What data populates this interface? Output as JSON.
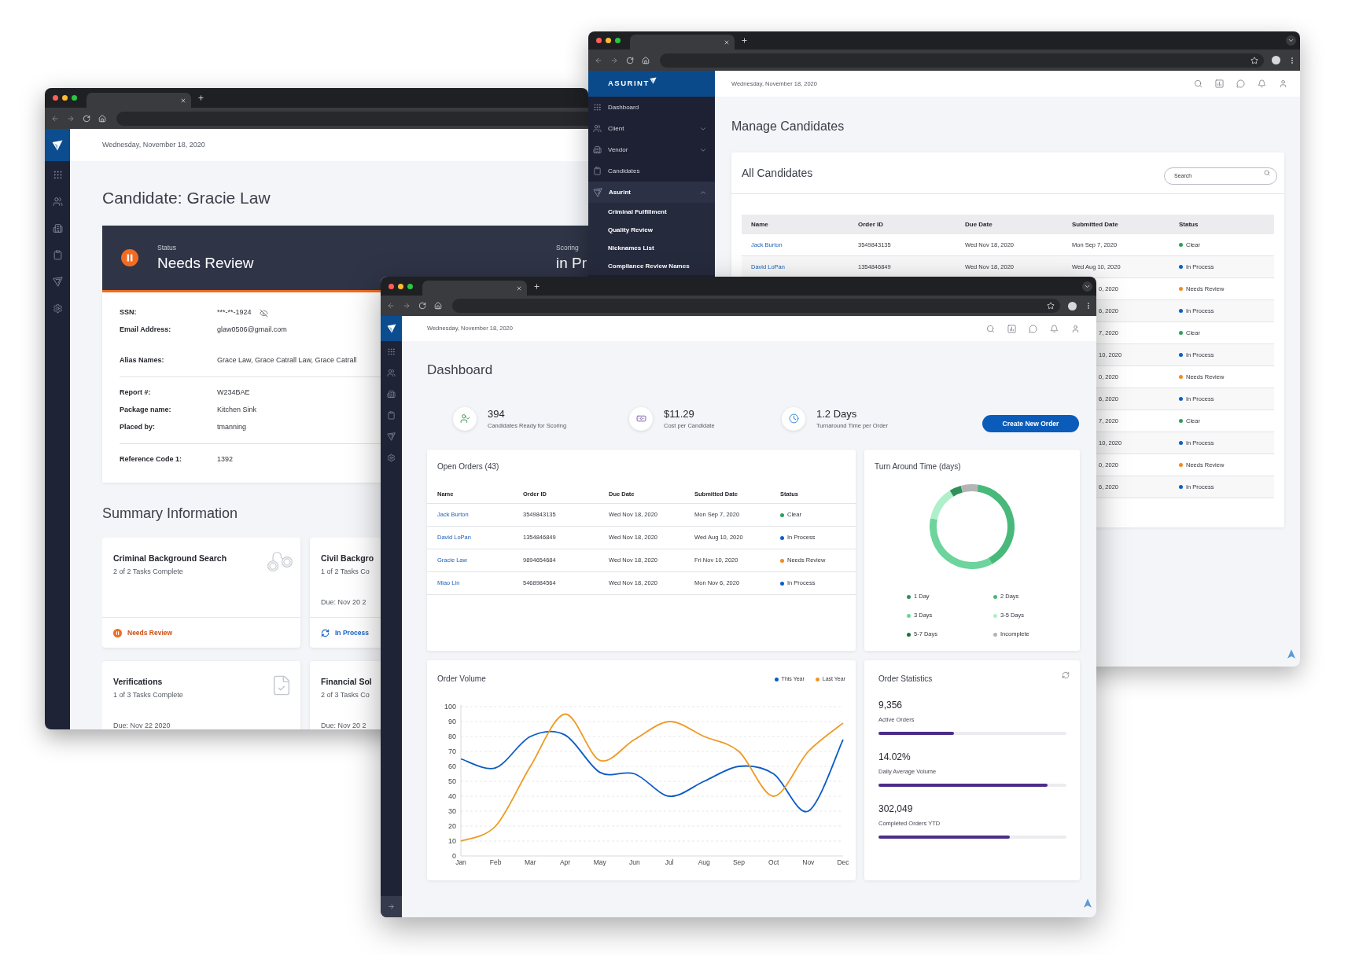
{
  "candidate_window": {
    "date": "Wednesday, November 18, 2020",
    "title": "Candidate: Gracie Law",
    "status": {
      "label": "Status",
      "value": "Needs Review"
    },
    "scoring": {
      "label": "Scoring",
      "value": "in Pr"
    },
    "details": [
      [
        {
          "label": "SSN:",
          "value": "***-**-1924",
          "masked": true
        },
        {
          "label": "Email Address:",
          "value": "glaw0506@gmail.com"
        },
        {
          "label": "Alias Names:",
          "value": "Grace Law, Grace Catrall Law, Grace Catrall"
        }
      ],
      [
        {
          "label": "Report #:",
          "value": "W234BAE"
        },
        {
          "label": "Package name:",
          "value": "Kitchen Sink"
        },
        {
          "label": "Placed by:",
          "value": "tmanning"
        }
      ],
      [
        {
          "label": "Reference Code 1:",
          "value": "1392"
        }
      ]
    ],
    "summary": {
      "title": "Summary Information",
      "cards": [
        {
          "title": "Criminal Background Search",
          "progress": "2 of 2 Tasks Complete",
          "status": {
            "kind": "needs_review",
            "label": "Needs Review"
          }
        },
        {
          "title": "Civil Backgro",
          "progress": "1 of 2 Tasks Co",
          "due": "Due: Nov 20 2",
          "status": {
            "kind": "in_process",
            "label": "In Process"
          }
        },
        {
          "title": "Verifications",
          "progress": "1 of 3 Tasks Complete",
          "due": "Due: Nov 22 2020"
        },
        {
          "title": "Financial Sol",
          "progress": "2 of 3 Tasks Co",
          "due": "Due: Nov 20 2"
        }
      ]
    }
  },
  "candidates_window": {
    "brand": "ASURINT",
    "date": "Wednesday, November 18, 2020",
    "nav": [
      {
        "kind": "link",
        "label": "Dashboard"
      },
      {
        "kind": "group",
        "label": "Client",
        "expanded": false
      },
      {
        "kind": "group",
        "label": "Vendor",
        "expanded": false
      },
      {
        "kind": "link",
        "label": "Candidates"
      },
      {
        "kind": "group",
        "label": "Asurint",
        "expanded": true,
        "children": [
          {
            "label": "Criminal Fulfillment"
          },
          {
            "label": "Quality Review"
          },
          {
            "label": "Nicknames List"
          },
          {
            "label": "Compliance Review Names"
          }
        ]
      }
    ],
    "title": "Manage Candidates",
    "card_title": "All Candidates",
    "search": {
      "placeholder": "Search"
    },
    "table": {
      "columns": [
        "Name",
        "Order ID",
        "Due Date",
        "Submitted Date",
        "Status"
      ],
      "rows": [
        {
          "name": "Jack Burton",
          "order_id": "3549843135",
          "due_date": "Wed Nov 18, 2020",
          "submitted_date": "Mon Sep 7, 2020",
          "status": "Clear",
          "color": "#2e9e5e"
        },
        {
          "name": "David LoPan",
          "order_id": "1354846849",
          "due_date": "Wed Nov 18, 2020",
          "submitted_date": "Wed Aug 10, 2020",
          "status": "In Process",
          "color": "#0b5fc6"
        },
        {
          "submitted_date": "0, 2020",
          "status": "Needs Review",
          "color": "#ef8d1f"
        },
        {
          "submitted_date": "6, 2020",
          "status": "In Process",
          "color": "#0b5fc6"
        },
        {
          "submitted_date": "7, 2020",
          "status": "Clear",
          "color": "#2e9e5e"
        },
        {
          "submitted_date": "10, 2020",
          "status": "In Process",
          "color": "#0b5fc6"
        },
        {
          "submitted_date": "0, 2020",
          "status": "Needs Review",
          "color": "#ef8d1f"
        },
        {
          "submitted_date": "6, 2020",
          "status": "In Process",
          "color": "#0b5fc6"
        },
        {
          "submitted_date": "7, 2020",
          "status": "Clear",
          "color": "#2e9e5e"
        },
        {
          "submitted_date": "10, 2020",
          "status": "In Process",
          "color": "#0b5fc6"
        },
        {
          "submitted_date": "0, 2020",
          "status": "Needs Review",
          "color": "#ef8d1f"
        },
        {
          "submitted_date": "6, 2020",
          "status": "In Process",
          "color": "#0b5fc6"
        }
      ]
    }
  },
  "dashboard_window": {
    "date": "Wednesday, November 18, 2020",
    "title": "Dashboard",
    "kpis": [
      {
        "value": "394",
        "label": "Candidates Ready for Scoring"
      },
      {
        "value": "$11.29",
        "label": "Cost per Candidate"
      },
      {
        "value": "1.2 Days",
        "label": "Turnaround Time per Order"
      }
    ],
    "create_button": "Create New Order",
    "open_orders": {
      "title": "Open Orders (43)",
      "columns": [
        "Name",
        "Order ID",
        "Due Date",
        "Submitted Date",
        "Status"
      ],
      "rows": [
        {
          "name": "Jack Burton",
          "order_id": "3549843135",
          "due_date": "Wed Nov 18, 2020",
          "submitted_date": "Mon Sep 7, 2020",
          "status": "Clear",
          "color": "#2e9e5e"
        },
        {
          "name": "David LoPan",
          "order_id": "1354846849",
          "due_date": "Wed Nov 18, 2020",
          "submitted_date": "Wed Aug 10, 2020",
          "status": "In Process",
          "color": "#0b5fc6"
        },
        {
          "name": "Gracie Law",
          "order_id": "9894654684",
          "due_date": "Wed Nov 18, 2020",
          "submitted_date": "Fri Nov 10, 2020",
          "status": "Needs Review",
          "color": "#ef8d1f"
        },
        {
          "name": "Miao Lin",
          "order_id": "5468984564",
          "due_date": "Wed Nov 18, 2020",
          "submitted_date": "Mon Nov 6, 2020",
          "status": "In Process",
          "color": "#0b5fc6"
        }
      ]
    },
    "turnaround": {
      "title": "Turn Around Time (days)",
      "legend": [
        {
          "label": "1 Day",
          "color": "#2f9058"
        },
        {
          "label": "2 Days",
          "color": "#48b97a"
        },
        {
          "label": "3 Days",
          "color": "#6cd49c"
        },
        {
          "label": "3-5 Days",
          "color": "#aef0c9"
        },
        {
          "label": "5-7 Days",
          "color": "#1f6f40"
        },
        {
          "label": "Incomplete",
          "color": "#b4b4b4"
        }
      ]
    },
    "order_volume": {
      "title": "Order Volume",
      "chart_data": {
        "type": "line",
        "categories": [
          "Jan",
          "Feb",
          "Mar",
          "Apr",
          "May",
          "Jun",
          "Jul",
          "Aug",
          "Sep",
          "Oct",
          "Nov",
          "Dec"
        ],
        "series": [
          {
            "name": "This Year",
            "color": "#0b5cc4",
            "values": [
              65,
              59,
              80,
              81,
              56,
              55,
              40,
              50,
              60,
              55,
              30,
              78
            ]
          },
          {
            "name": "Last Year",
            "color": "#ee9a24",
            "values": [
              10,
              20,
              60,
              95,
              64,
              78,
              90,
              80,
              70,
              40,
              70,
              89
            ]
          }
        ],
        "ylim": [
          0,
          100
        ],
        "yticks": [
          0,
          10,
          20,
          30,
          40,
          50,
          60,
          70,
          80,
          90,
          100
        ],
        "grid": true
      }
    },
    "order_statistics": {
      "title": "Order Statistics",
      "stats": [
        {
          "value": "9,356",
          "label": "Active Orders",
          "level": 0.4
        },
        {
          "value": "14.02%",
          "label": "Daily Average Volume",
          "level": 0.9
        },
        {
          "value": "302,049",
          "label": "Completed Orders YTD",
          "level": 0.7
        }
      ]
    }
  }
}
